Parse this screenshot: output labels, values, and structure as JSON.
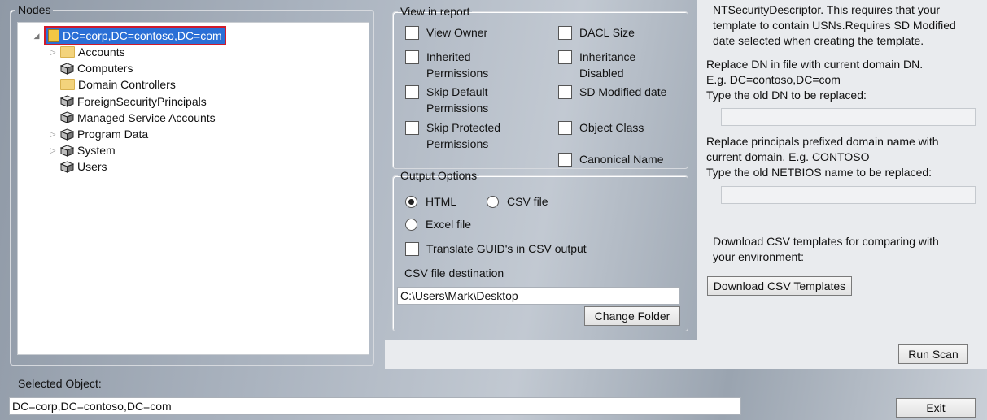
{
  "tree": {
    "group_label": "Nodes",
    "root": "DC=corp,DC=contoso,DC=com",
    "items": [
      {
        "label": "Accounts",
        "icon": "folder-icon",
        "expandable": true
      },
      {
        "label": "Computers",
        "icon": "container-icon",
        "expandable": false
      },
      {
        "label": "Domain Controllers",
        "icon": "folder-icon",
        "expandable": false
      },
      {
        "label": "ForeignSecurityPrincipals",
        "icon": "container-icon",
        "expandable": false
      },
      {
        "label": "Managed Service Accounts",
        "icon": "container-icon",
        "expandable": false
      },
      {
        "label": "Program Data",
        "icon": "container-icon",
        "expandable": true
      },
      {
        "label": "System",
        "icon": "container-icon",
        "expandable": true
      },
      {
        "label": "Users",
        "icon": "container-icon",
        "expandable": false
      }
    ]
  },
  "view_in_report": {
    "legend": "View in report",
    "view_owner": "View Owner",
    "dacl_size": "DACL Size",
    "inherited_permissions": "Inherited Permissions",
    "inheritance_disabled": "Inheritance Disabled",
    "skip_default_permissions": "Skip Default Permissions",
    "sd_modified_date": "SD Modified date",
    "skip_protected_permissions": "Skip Protected Permissions",
    "object_class": "Object Class",
    "canonical_name": "Canonical Name"
  },
  "output_options": {
    "legend": "Output Options",
    "html": "HTML",
    "csv_file": "CSV file",
    "excel_file": "Excel file",
    "translate_guid": "Translate GUID's in CSV output",
    "csv_destination_label": "CSV file destination",
    "csv_destination_value": "C:\\Users\\Mark\\Desktop",
    "change_folder": "Change Folder"
  },
  "right_panel": {
    "usn_line1": "NTSecurityDescriptor. This requires that your",
    "usn_line2": "template to contain USNs.Requires SD Modified",
    "usn_line3": "date selected when creating the template.",
    "replace_dn_line1": "Replace DN in file with current domain DN.",
    "replace_dn_line2": "E.g. DC=contoso,DC=com",
    "replace_dn_line3": "Type the old DN to be replaced:",
    "replace_principals_line1": "Replace principals prefixed domain name with",
    "replace_principals_line2": "current domain. E.g. CONTOSO",
    "replace_principals_line3": "Type the old NETBIOS name to be replaced:",
    "download_line1": "Download CSV templates for comparing with",
    "download_line2": "your environment:",
    "download_button": "Download CSV Templates"
  },
  "run_scan": "Run Scan",
  "selected_object": {
    "label": "Selected Object:",
    "value": "DC=corp,DC=contoso,DC=com"
  },
  "exit": "Exit"
}
